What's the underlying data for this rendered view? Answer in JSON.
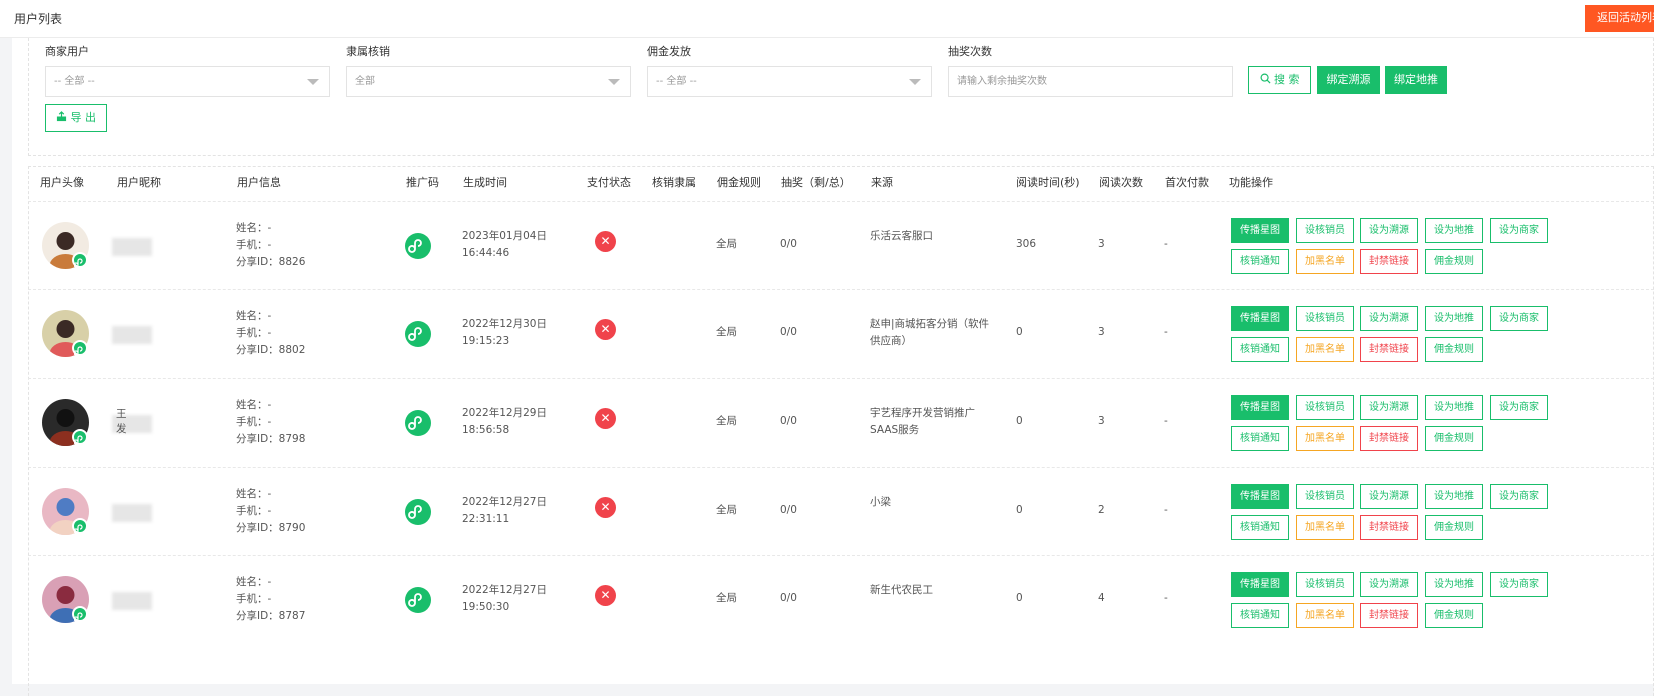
{
  "header": {
    "title": "用户列表",
    "back_button": "返回活动列表"
  },
  "filters": {
    "merchant": {
      "label": "商家用户",
      "value": "-- 全部 --"
    },
    "verify": {
      "label": "隶属核销",
      "value": "全部"
    },
    "commission": {
      "label": "佣金发放",
      "value": "-- 全部 --"
    },
    "lottery": {
      "label": "抽奖次数",
      "placeholder": "请输入剩余抽奖次数"
    },
    "search_button": "搜 索",
    "bind_source_button": "绑定溯源",
    "bind_local_button": "绑定地推",
    "export_button": "导 出"
  },
  "table": {
    "headers": [
      "用户头像",
      "用户昵称",
      "用户信息",
      "推广码",
      "生成时间",
      "支付状态",
      "核销隶属",
      "佣金规则",
      "抽奖（剩/总）",
      "来源",
      "阅读时间(秒)",
      "阅读次数",
      "首次付款",
      "功能操作"
    ],
    "info_labels": {
      "name": "姓名：-",
      "phone": "手机：-",
      "share_prefix": "分享ID："
    },
    "rows": [
      {
        "share_id": "分享ID：8826",
        "date": "2023年01月04日",
        "time": "16:44:46",
        "rule": "全局",
        "lottery": "0/0",
        "source_1": "乐活云客服口",
        "source_2": "",
        "read_time": "306",
        "read_count": "3",
        "first_pay": "-",
        "nick": ""
      },
      {
        "share_id": "分享ID：8802",
        "date": "2022年12月30日",
        "time": "19:15:23",
        "rule": "全局",
        "lottery": "0/0",
        "source_1": "赵申|商城拓客分销（软件",
        "source_2": "供应商）",
        "read_time": "0",
        "read_count": "3",
        "first_pay": "-",
        "nick": ""
      },
      {
        "share_id": "分享ID：8798",
        "date": "2022年12月29日",
        "time": "18:56:58",
        "rule": "全局",
        "lottery": "0/0",
        "source_1": "宇艺程序开发营销推广",
        "source_2": "SAAS服务",
        "read_time": "0",
        "read_count": "3",
        "first_pay": "-",
        "nick": "王",
        "nick_2": "发"
      },
      {
        "share_id": "分享ID：8790",
        "date": "2022年12月27日",
        "time": "22:31:11",
        "rule": "全局",
        "lottery": "0/0",
        "source_1": "小梁",
        "source_2": "",
        "read_time": "0",
        "read_count": "2",
        "first_pay": "-",
        "nick": ""
      },
      {
        "share_id": "分享ID：8787",
        "date": "2022年12月27日",
        "time": "19:50:30",
        "rule": "全局",
        "lottery": "0/0",
        "source_1": "新生代农民工",
        "source_2": "",
        "read_time": "0",
        "read_count": "4",
        "first_pay": "-",
        "nick": ""
      }
    ],
    "actions": [
      "传播星图",
      "设核销员",
      "设为溯源",
      "设为地推",
      "设为商家",
      "核销通知",
      "加黑名单",
      "封禁链接",
      "佣金规则"
    ]
  },
  "colors": {
    "accent": "#19be6b",
    "danger": "#f0434b",
    "warning": "#f5a623",
    "topbar_button": "#ff5722"
  },
  "icons": {
    "search": "search-icon",
    "export": "export-icon",
    "promo_code": "mini-program-icon",
    "pay_status": "close-circle-icon"
  }
}
